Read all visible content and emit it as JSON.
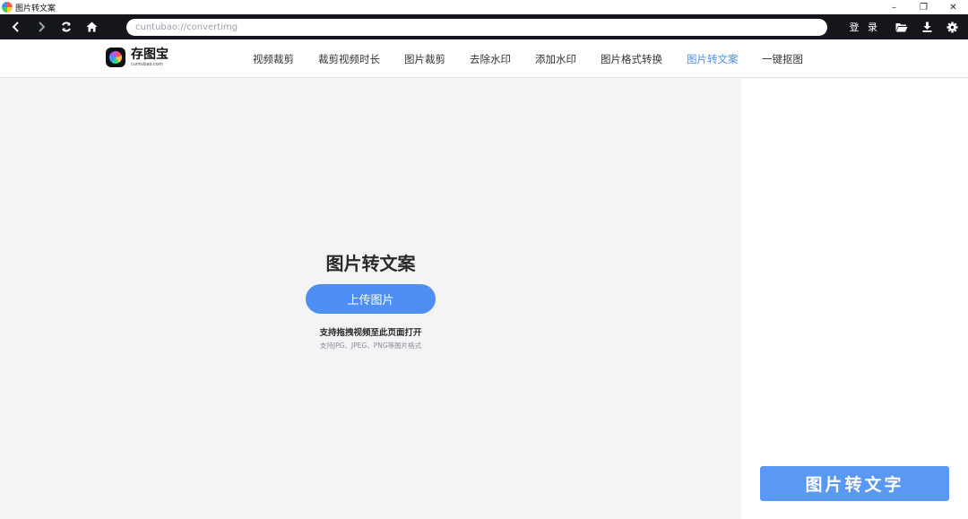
{
  "window": {
    "title": "图片转文案",
    "controls": [
      "–",
      "❐",
      "✕"
    ]
  },
  "toolbar": {
    "url": "cuntubao://convertimg",
    "login_label": "登 录",
    "icons": [
      "back-icon",
      "forward-icon",
      "refresh-icon",
      "home-icon",
      "folder-icon",
      "download-icon",
      "gear-icon"
    ]
  },
  "site": {
    "logo_name": "存图宝",
    "logo_domain": "cuntubao.com",
    "nav": [
      {
        "label": "视频裁剪",
        "active": false
      },
      {
        "label": "裁剪视频时长",
        "active": false
      },
      {
        "label": "图片裁剪",
        "active": false
      },
      {
        "label": "去除水印",
        "active": false
      },
      {
        "label": "添加水印",
        "active": false
      },
      {
        "label": "图片格式转换",
        "active": false
      },
      {
        "label": "图片转文案",
        "active": true
      },
      {
        "label": "一键抠图",
        "active": false
      }
    ],
    "active_color": "#4a90f0"
  },
  "main": {
    "title": "图片转文案",
    "upload_label": "上传图片",
    "hint": "支持拖拽视频至此页面打开",
    "formats": "支持JPG、JPEG、PNG等图片格式"
  },
  "side": {
    "ocr_button_label": "图片转文字",
    "button_color": "#5a98f5"
  }
}
